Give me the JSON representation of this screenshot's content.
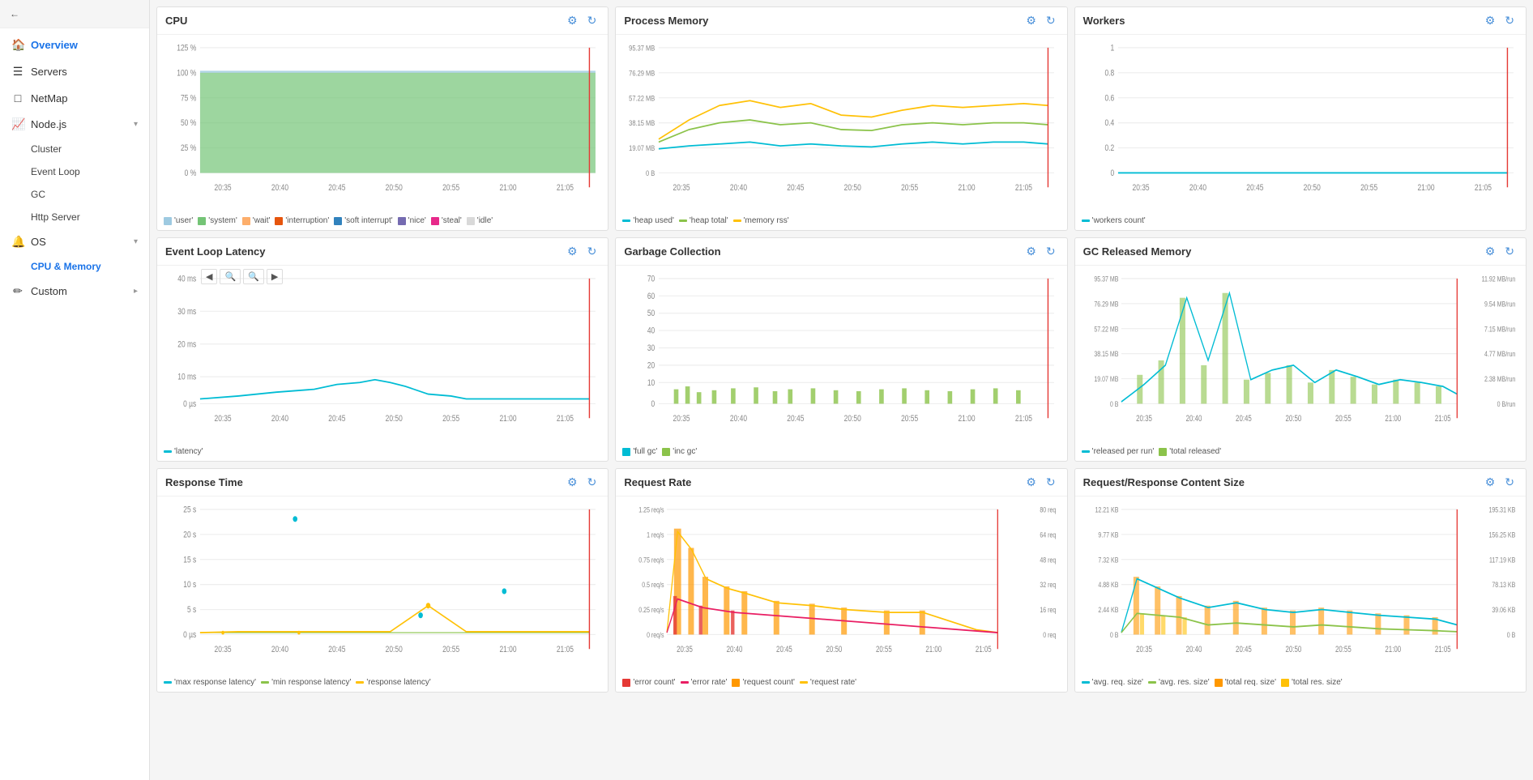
{
  "sidebar": {
    "back_label": "Back",
    "nav_items": [
      {
        "id": "overview",
        "label": "Overview",
        "icon": "🏠",
        "active": true,
        "type": "top"
      },
      {
        "id": "servers",
        "label": "Servers",
        "icon": "☰",
        "type": "top"
      },
      {
        "id": "netmap",
        "label": "NetMap",
        "icon": "□",
        "type": "top"
      },
      {
        "id": "nodejs",
        "label": "Node.js",
        "icon": "📈",
        "type": "expandable",
        "expanded": true
      },
      {
        "id": "cluster",
        "label": "Cluster",
        "type": "sub"
      },
      {
        "id": "eventloop",
        "label": "Event Loop",
        "type": "sub"
      },
      {
        "id": "gc",
        "label": "GC",
        "type": "sub"
      },
      {
        "id": "httpserver",
        "label": "Http Server",
        "type": "sub"
      },
      {
        "id": "os",
        "label": "OS",
        "icon": "🔔",
        "type": "expandable",
        "expanded": true
      },
      {
        "id": "cpumemory",
        "label": "CPU & Memory",
        "type": "sub",
        "active": true
      },
      {
        "id": "custom",
        "label": "Custom",
        "icon": "✏",
        "type": "expandable_top"
      }
    ]
  },
  "charts": {
    "row1": [
      {
        "id": "cpu",
        "title": "CPU",
        "y_labels": [
          "125 %",
          "100 %",
          "75 %",
          "50 %",
          "25 %",
          "0 %"
        ],
        "x_labels": [
          "20:35",
          "20:40",
          "20:45",
          "20:50",
          "20:55",
          "21:00",
          "21:05"
        ],
        "legend": [
          {
            "color": "#9ecae1",
            "label": "'user'",
            "type": "square"
          },
          {
            "color": "#74c476",
            "label": "'system'",
            "type": "square"
          },
          {
            "color": "#fdae6b",
            "label": "'wait'",
            "type": "square"
          },
          {
            "color": "#e6550d",
            "label": "'interruption'",
            "type": "square"
          },
          {
            "color": "#3182bd",
            "label": "'soft interrupt'",
            "type": "square"
          },
          {
            "color": "#756bb1",
            "label": "'nice'",
            "type": "square"
          },
          {
            "color": "#e7298a",
            "label": "'steal'",
            "type": "square"
          },
          {
            "color": "#d9d9d9",
            "label": "'idle'",
            "type": "square"
          }
        ]
      },
      {
        "id": "process-memory",
        "title": "Process Memory",
        "y_labels": [
          "95.37 MB",
          "76.29 MB",
          "57.22 MB",
          "38.15 MB",
          "19.07 MB",
          "0 B"
        ],
        "x_labels": [
          "20:35",
          "20:40",
          "20:45",
          "20:50",
          "20:55",
          "21:00",
          "21:05"
        ],
        "legend": [
          {
            "color": "#00bcd4",
            "label": "'heap used'",
            "type": "line"
          },
          {
            "color": "#8bc34a",
            "label": "'heap total'",
            "type": "line"
          },
          {
            "color": "#ffc107",
            "label": "'memory rss'",
            "type": "line"
          }
        ]
      },
      {
        "id": "workers",
        "title": "Workers",
        "y_labels": [
          "1",
          "0.8",
          "0.6",
          "0.4",
          "0.2",
          "0"
        ],
        "x_labels": [
          "20:35",
          "20:40",
          "20:45",
          "20:50",
          "20:55",
          "21:00",
          "21:05"
        ],
        "legend": [
          {
            "color": "#00bcd4",
            "label": "'workers count'",
            "type": "line"
          }
        ]
      }
    ],
    "row2": [
      {
        "id": "event-loop",
        "title": "Event Loop Latency",
        "y_labels": [
          "40 ms",
          "30 ms",
          "20 ms",
          "10 ms",
          "0 µs"
        ],
        "x_labels": [
          "20:35",
          "20:40",
          "20:45",
          "20:50",
          "20:55",
          "21:00",
          "21:05"
        ],
        "legend": [
          {
            "color": "#00bcd4",
            "label": "'latency'",
            "type": "line"
          }
        ],
        "has_nav": true
      },
      {
        "id": "garbage-collection",
        "title": "Garbage Collection",
        "y_labels": [
          "70",
          "60",
          "50",
          "40",
          "30",
          "20",
          "10",
          "0"
        ],
        "x_labels": [
          "20:35",
          "20:40",
          "20:45",
          "20:50",
          "20:55",
          "21:00",
          "21:05"
        ],
        "legend": [
          {
            "color": "#00bcd4",
            "label": "'full gc'",
            "type": "square"
          },
          {
            "color": "#8bc34a",
            "label": "'inc gc'",
            "type": "square"
          }
        ]
      },
      {
        "id": "gc-released-memory",
        "title": "GC Released Memory",
        "y_labels": [
          "95.37 MB",
          "76.29 MB",
          "57.22 MB",
          "38.15 MB",
          "19.07 MB",
          "0 B"
        ],
        "y_labels_right": [
          "11.92 MB/run",
          "9.54 MB/run",
          "7.15 MB/run",
          "4.77 MB/run",
          "2.38 MB/run",
          "0 B/run"
        ],
        "x_labels": [
          "20:35",
          "20:40",
          "20:45",
          "20:50",
          "20:55",
          "21:00",
          "21:05"
        ],
        "legend": [
          {
            "color": "#00bcd4",
            "label": "'released per run'",
            "type": "line"
          },
          {
            "color": "#8bc34a",
            "label": "'total released'",
            "type": "square"
          }
        ]
      }
    ],
    "row3": [
      {
        "id": "response-time",
        "title": "Response Time",
        "y_labels": [
          "25 s",
          "20 s",
          "15 s",
          "10 s",
          "5 s",
          "0 µs"
        ],
        "x_labels": [
          "20:35",
          "20:40",
          "20:45",
          "20:50",
          "20:55",
          "21:00",
          "21:05"
        ],
        "legend": [
          {
            "color": "#00bcd4",
            "label": "'max response latency'",
            "type": "line"
          },
          {
            "color": "#8bc34a",
            "label": "'min response latency'",
            "type": "line"
          },
          {
            "color": "#ffc107",
            "label": "'response latency'",
            "type": "line"
          }
        ]
      },
      {
        "id": "request-rate",
        "title": "Request Rate",
        "y_labels_left": [
          "1.25 req/s",
          "1 req/s",
          "0.75 req/s",
          "0.5 req/s",
          "0.25 req/s",
          "0 req/s"
        ],
        "y_labels_right": [
          "80 req",
          "64 req",
          "48 req",
          "32 req",
          "16 req",
          "0 req"
        ],
        "x_labels": [
          "20:35",
          "20:40",
          "20:45",
          "20:50",
          "20:55",
          "21:00",
          "21:05"
        ],
        "legend": [
          {
            "color": "#e53935",
            "label": "'error count'",
            "type": "square"
          },
          {
            "color": "#e91e63",
            "label": "'error rate'",
            "type": "line"
          },
          {
            "color": "#ff9800",
            "label": "'request count'",
            "type": "square"
          },
          {
            "color": "#ffc107",
            "label": "'request rate'",
            "type": "line"
          }
        ]
      },
      {
        "id": "content-size",
        "title": "Request/Response Content Size",
        "y_labels_left": [
          "12.21 KB",
          "9.77 KB",
          "7.32 KB",
          "4.88 KB",
          "2.44 KB",
          "0 B"
        ],
        "y_labels_right": [
          "195.31 KB",
          "156.25 KB",
          "117.19 KB",
          "78.13 KB",
          "39.06 KB",
          "0 B"
        ],
        "x_labels": [
          "20:35",
          "20:40",
          "20:45",
          "20:50",
          "20:55",
          "21:00",
          "21:05"
        ],
        "legend": [
          {
            "color": "#00bcd4",
            "label": "'avg. req. size'",
            "type": "line"
          },
          {
            "color": "#8bc34a",
            "label": "'avg. res. size'",
            "type": "line"
          },
          {
            "color": "#ff9800",
            "label": "'total req. size'",
            "type": "square"
          },
          {
            "color": "#ffc107",
            "label": "'total res. size'",
            "type": "square"
          }
        ]
      }
    ]
  },
  "icons": {
    "back": "←",
    "settings": "⚙",
    "refresh": "↻",
    "zoom_in": "🔍+",
    "zoom_out": "🔍-",
    "pan_left": "◀",
    "pan_right": "▶"
  }
}
